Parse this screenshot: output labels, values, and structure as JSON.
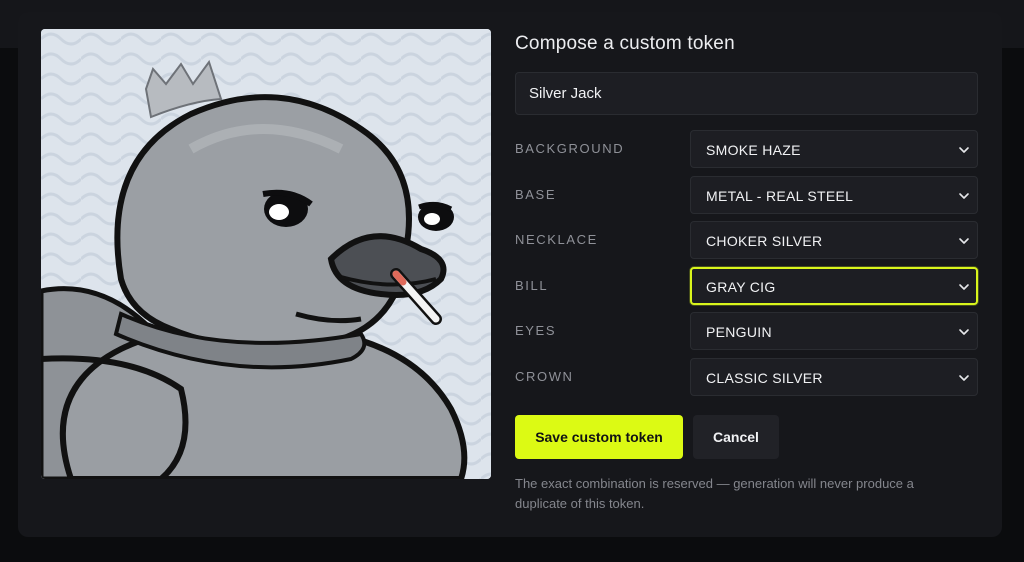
{
  "modal": {
    "title": "Compose a custom token",
    "name_input": {
      "value": "Silver Jack",
      "placeholder": ""
    },
    "attributes": [
      {
        "label": "BACKGROUND",
        "value": "SMOKE HAZE",
        "focused": false
      },
      {
        "label": "BASE",
        "value": "METAL - REAL STEEL",
        "focused": false
      },
      {
        "label": "NECKLACE",
        "value": "CHOKER SILVER",
        "focused": false
      },
      {
        "label": "BILL",
        "value": "GRAY CIG",
        "focused": true
      },
      {
        "label": "EYES",
        "value": "PENGUIN",
        "focused": false
      },
      {
        "label": "CROWN",
        "value": "CLASSIC SILVER",
        "focused": false
      }
    ],
    "save_label": "Save custom token",
    "cancel_label": "Cancel",
    "note": "The exact combination is reserved — generation will never produce a duplicate of this token."
  },
  "preview": {
    "icon": "duck-token-image",
    "description_icons": [
      "crown-icon",
      "cigarette-icon"
    ]
  },
  "colors": {
    "accent": "#dcfa14",
    "modal_bg": "#16171b",
    "field_bg": "#1d1e23",
    "label": "#8f9198",
    "text": "#f1f2f4"
  }
}
